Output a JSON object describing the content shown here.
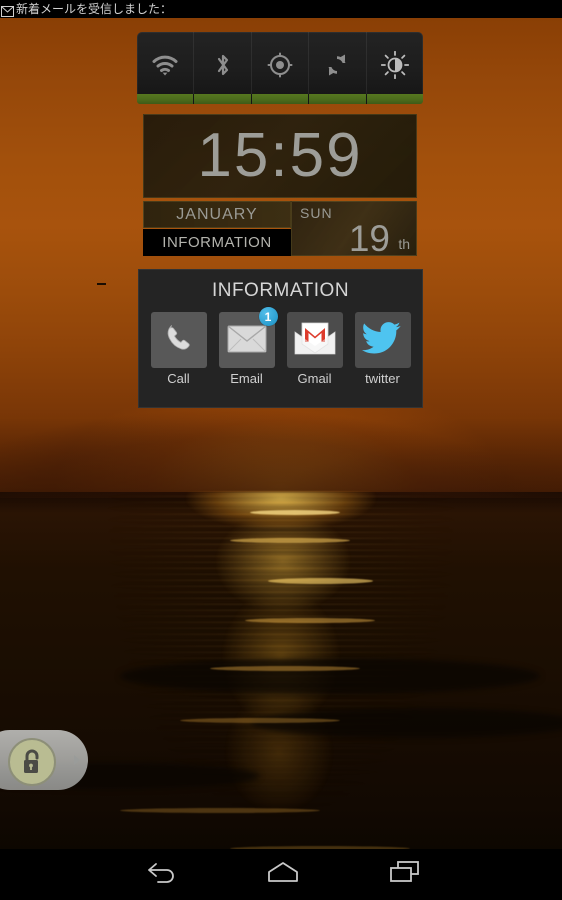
{
  "status_bar": {
    "icon": "new-mail-icon",
    "ticker_text": "新着メールを受信しました："
  },
  "power_widget": {
    "toggles": [
      {
        "label": "Wi-Fi",
        "icon": "wifi-icon",
        "state": "on"
      },
      {
        "label": "Bluetooth",
        "icon": "bluetooth-icon",
        "state": "on"
      },
      {
        "label": "GPS",
        "icon": "location-icon",
        "state": "on"
      },
      {
        "label": "Sync",
        "icon": "sync-icon",
        "state": "on"
      },
      {
        "label": "Brightness",
        "icon": "brightness-icon",
        "state": "on"
      }
    ],
    "indicator_color": "#4a6a1c"
  },
  "clock_widget": {
    "time": "15:59",
    "month": "JANUARY",
    "info_label": "INFORMATION",
    "day_of_week": "SUN",
    "day_number": "19",
    "day_suffix": "th",
    "text_color": "#9d9d98"
  },
  "info_panel": {
    "title": "INFORMATION",
    "apps": [
      {
        "label": "Call",
        "icon": "phone-icon",
        "badge": ""
      },
      {
        "label": "Email",
        "icon": "envelope-icon",
        "badge": "1"
      },
      {
        "label": "Gmail",
        "icon": "gmail-icon",
        "badge": ""
      },
      {
        "label": "twitter",
        "icon": "twitter-bird-icon",
        "badge": ""
      }
    ],
    "badge_color": "#2a9ed0"
  },
  "unlock_slider": {
    "icon": "unlock-padlock-icon",
    "arrow": "chevron-right-icon"
  },
  "nav_bar": {
    "buttons": [
      {
        "name": "back",
        "icon": "back-arrow-icon"
      },
      {
        "name": "home",
        "icon": "home-icon"
      },
      {
        "name": "recents",
        "icon": "recent-apps-icon"
      }
    ]
  },
  "wallpaper": {
    "description": "sunset-seascape",
    "sky_color": "#a2500c",
    "sea_color": "#1b0e02",
    "sun_reflection_color": "#ffd25a"
  }
}
